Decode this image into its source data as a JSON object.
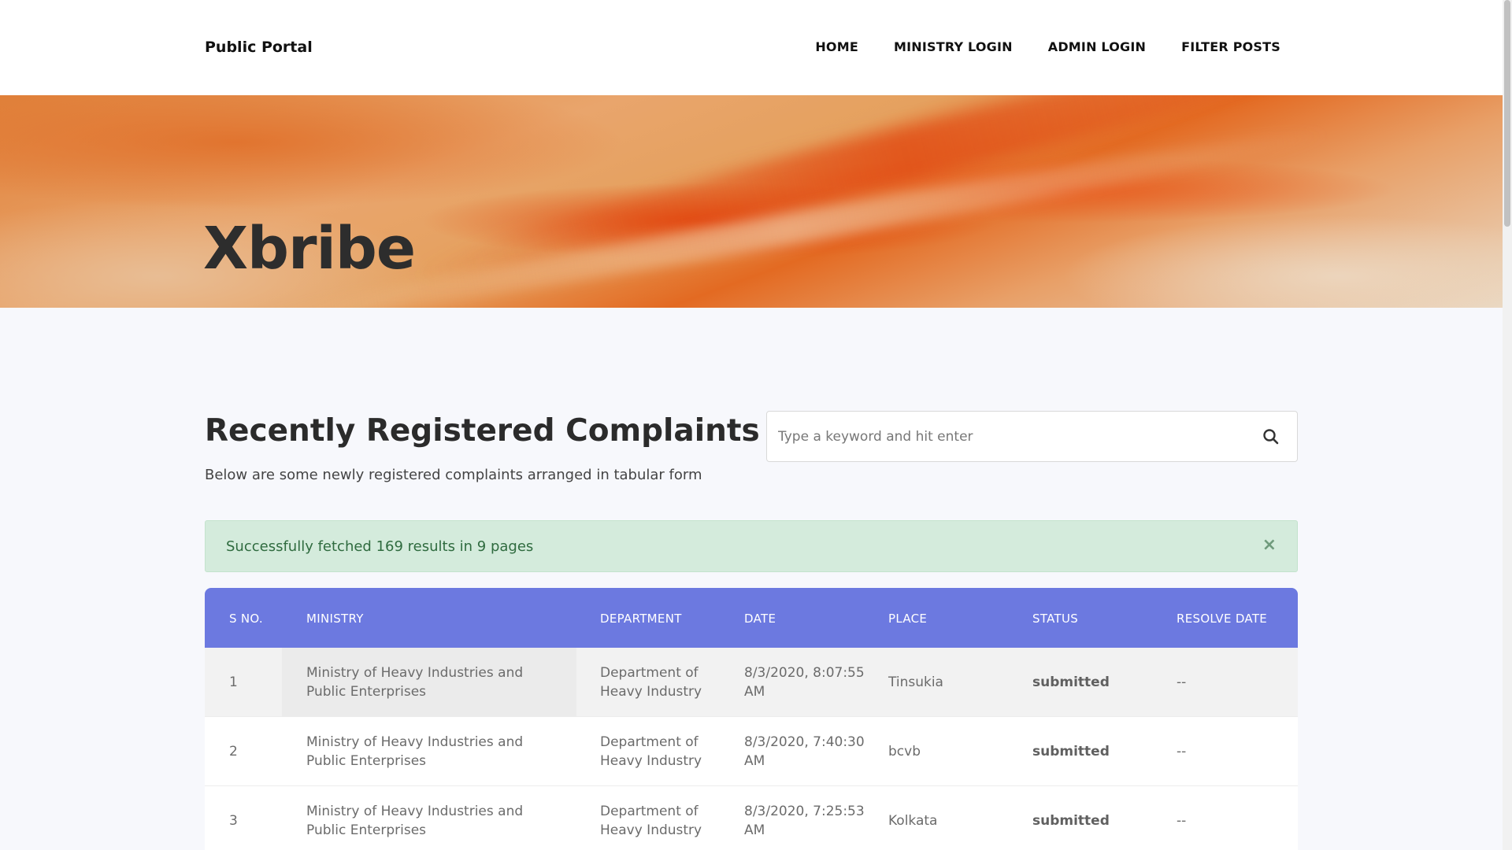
{
  "nav": {
    "brand": "Public Portal",
    "items": [
      {
        "label": "HOME"
      },
      {
        "label": "MINISTRY LOGIN"
      },
      {
        "label": "ADMIN LOGIN"
      },
      {
        "label": "FILTER POSTS"
      }
    ]
  },
  "hero": {
    "title": "Xbribe"
  },
  "section": {
    "title": "Recently Registered Complaints",
    "subtitle": "Below are some newly registered complaints arranged in tabular form"
  },
  "search": {
    "placeholder": "Type a keyword and hit enter",
    "icon": "search-icon"
  },
  "alert": {
    "message": "Successfully fetched 169 results in 9 pages",
    "close": "×"
  },
  "table": {
    "headers": [
      "S NO.",
      "MINISTRY",
      "DEPARTMENT",
      "DATE",
      "PLACE",
      "STATUS",
      "RESOLVE DATE"
    ],
    "rows": [
      {
        "sno": "1",
        "ministry": "Ministry of Heavy Industries and Public Enterprises",
        "department": "Department of Heavy Industry",
        "date": "8/3/2020, 8:07:55 AM",
        "place": "Tinsukia",
        "status": "submitted",
        "resolve_date": "--"
      },
      {
        "sno": "2",
        "ministry": "Ministry of Heavy Industries and Public Enterprises",
        "department": "Department of Heavy Industry",
        "date": "8/3/2020, 7:40:30 AM",
        "place": "bcvb",
        "status": "submitted",
        "resolve_date": "--"
      },
      {
        "sno": "3",
        "ministry": "Ministry of Heavy Industries and Public Enterprises",
        "department": "Department of Heavy Industry",
        "date": "8/3/2020, 7:25:53 AM",
        "place": "Kolkata",
        "status": "submitted",
        "resolve_date": "--"
      }
    ]
  },
  "colors": {
    "table_header": "#6c79e0",
    "alert_bg": "#d4ebdc",
    "alert_text": "#2f6b3f",
    "hero_accent": "#e24810"
  }
}
